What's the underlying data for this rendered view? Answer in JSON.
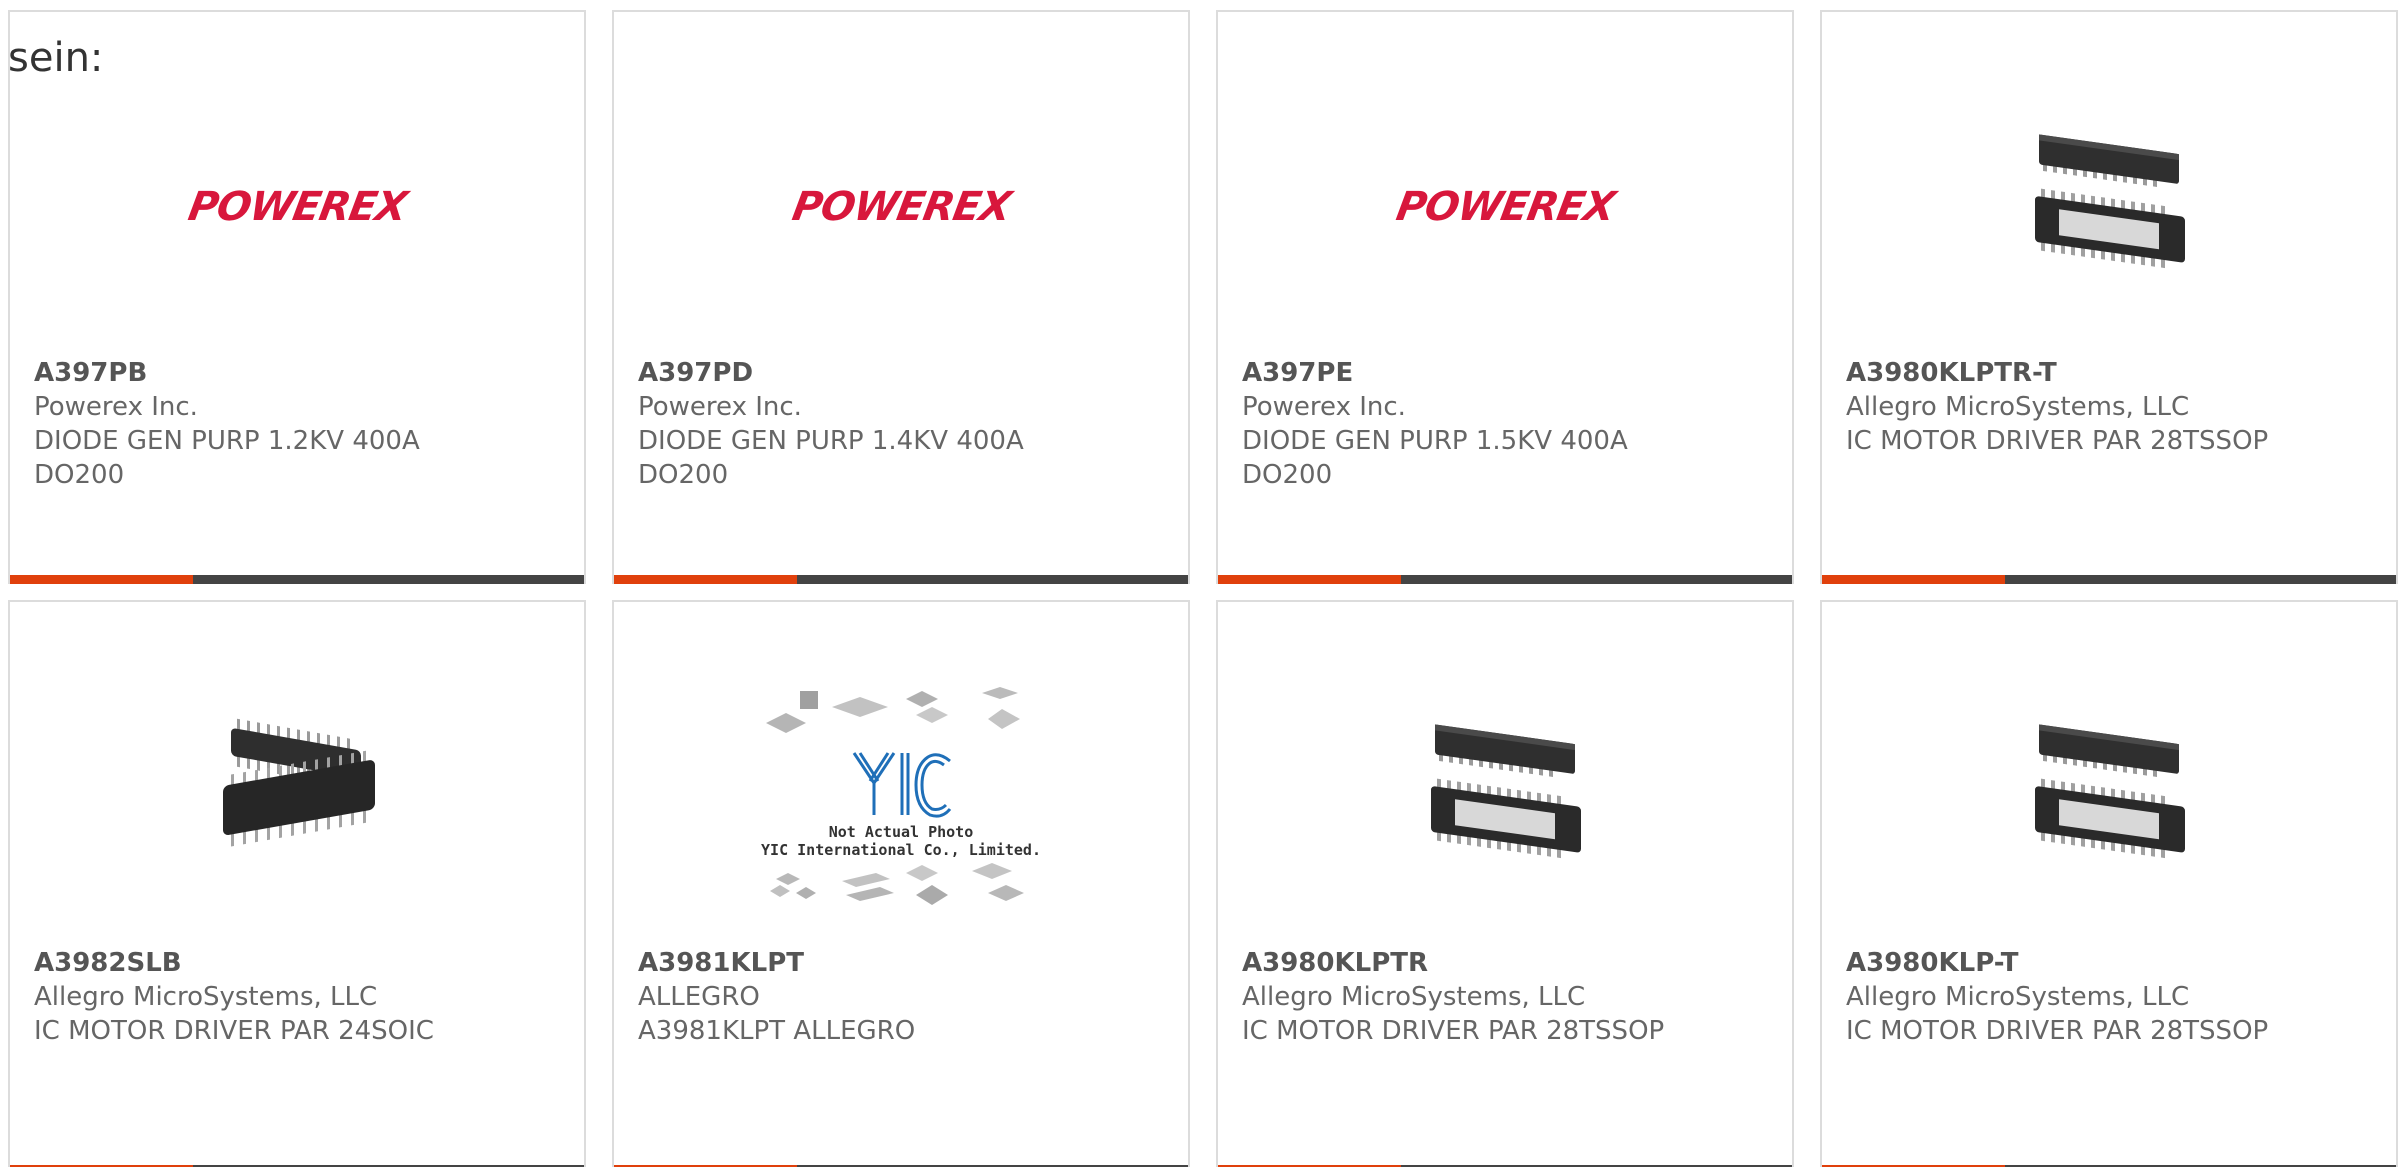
{
  "intro_text": "sein:",
  "colors": {
    "accent": "#e0400c",
    "bar": "#444444",
    "powerex_red": "#d8173c",
    "border": "#dcdcdc"
  },
  "cards": [
    {
      "image": "powerex-logo",
      "logo_text": "POWEREX",
      "part": "A397PB",
      "manufacturer": "Powerex Inc.",
      "description": "DIODE GEN PURP 1.2KV 400A",
      "package": "DO200"
    },
    {
      "image": "powerex-logo",
      "logo_text": "POWEREX",
      "part": "A397PD",
      "manufacturer": "Powerex Inc.",
      "description": "DIODE GEN PURP 1.4KV 400A",
      "package": "DO200"
    },
    {
      "image": "powerex-logo",
      "logo_text": "POWEREX",
      "part": "A397PE",
      "manufacturer": "Powerex Inc.",
      "description": "DIODE GEN PURP 1.5KV 400A",
      "package": "DO200"
    },
    {
      "image": "tssop-chip-photo",
      "part": "A3980KLPTR-T",
      "manufacturer": "Allegro MicroSystems, LLC",
      "description": "IC MOTOR DRIVER PAR 28TSSOP",
      "package": ""
    },
    {
      "image": "soic-chip-photo",
      "part": "A3982SLB",
      "manufacturer": "Allegro MicroSystems, LLC",
      "description": "IC MOTOR DRIVER PAR 24SOIC",
      "package": ""
    },
    {
      "image": "yic-placeholder",
      "placeholder_line1": "Not Actual Photo",
      "placeholder_line2": "YIC International Co., Limited.",
      "part": "A3981KLPT",
      "manufacturer": "ALLEGRO",
      "description": "A3981KLPT ALLEGRO",
      "package": ""
    },
    {
      "image": "tssop-chip-photo",
      "part": "A3980KLPTR",
      "manufacturer": "Allegro MicroSystems, LLC",
      "description": "IC MOTOR DRIVER PAR 28TSSOP",
      "package": ""
    },
    {
      "image": "tssop-chip-photo",
      "part": "A3980KLP-T",
      "manufacturer": "Allegro MicroSystems, LLC",
      "description": "IC MOTOR DRIVER PAR 28TSSOP",
      "package": ""
    }
  ]
}
